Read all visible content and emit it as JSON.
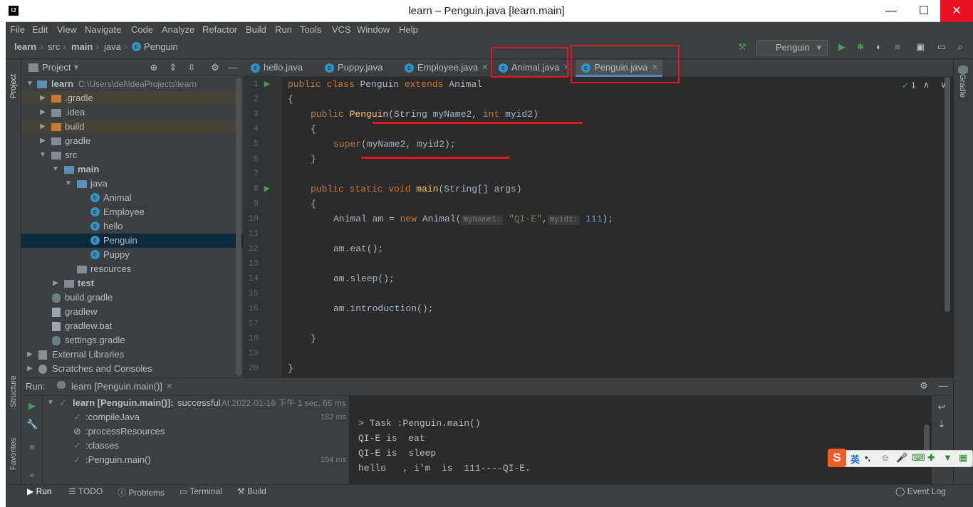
{
  "window": {
    "title": "learn – Penguin.java [learn.main]",
    "minimize": "—",
    "maximize": "☐",
    "close": "✕"
  },
  "menu": [
    "File",
    "Edit",
    "View",
    "Navigate",
    "Code",
    "Analyze",
    "Refactor",
    "Build",
    "Run",
    "Tools",
    "VCS",
    "Window",
    "Help"
  ],
  "breadcrumb": [
    "learn",
    "src",
    "main",
    "java",
    "Penguin"
  ],
  "run_config": "Penguin",
  "project_panel": {
    "title": "Project",
    "dropdown_icon": "▾"
  },
  "tree": [
    {
      "label": "learn",
      "path": "C:\\Users\\del\\IdeaProjects\\learn",
      "bold": true
    },
    {
      "label": ".gradle"
    },
    {
      "label": ".idea"
    },
    {
      "label": "build"
    },
    {
      "label": "gradle"
    },
    {
      "label": "src"
    },
    {
      "label": "main"
    },
    {
      "label": "java"
    },
    {
      "label": "Animal"
    },
    {
      "label": "Employee"
    },
    {
      "label": "hello"
    },
    {
      "label": "Penguin"
    },
    {
      "label": "Puppy"
    },
    {
      "label": "resources"
    },
    {
      "label": "test"
    },
    {
      "label": "build.gradle"
    },
    {
      "label": "gradlew"
    },
    {
      "label": "gradlew.bat"
    },
    {
      "label": "settings.gradle"
    },
    {
      "label": "External Libraries"
    },
    {
      "label": "Scratches and Consoles"
    }
  ],
  "editor_tabs": [
    "hello.java",
    "Puppy.java",
    "Employee.java",
    "Animal.java",
    "Penguin.java"
  ],
  "active_tab": "Penguin.java",
  "inspection": {
    "count": "1",
    "up": "∧",
    "down": "∨"
  },
  "code": {
    "line_numbers": [
      "1",
      "2",
      "3",
      "4",
      "5",
      "6",
      "7",
      "8",
      "9",
      "10",
      "11",
      "12",
      "13",
      "14",
      "15",
      "16",
      "17",
      "18",
      "19",
      "20"
    ],
    "l1": {
      "kw1": "public",
      "kw2": "class",
      "name": " Penguin ",
      "kw3": "extends",
      "rest": " Animal"
    },
    "l2": "{",
    "l3": {
      "kw": "public",
      "fn": "Penguin",
      "p1": "(String myName2, ",
      "kw2": "int",
      "p2": " myid2)"
    },
    "l4": "{",
    "l5": {
      "kw": "super",
      "rest": "(myName2, myid2);"
    },
    "l6": "}",
    "l8": {
      "kw1": "public",
      "kw2": "static",
      "kw3": "void",
      "fn": "main",
      "rest": "(String[] args)"
    },
    "l9": "{",
    "l10": {
      "a": "Animal am = ",
      "kw": "new",
      "b": " Animal(",
      "hint1": "myName1:",
      "s": "\"QI-E\"",
      "c": ",",
      "hint2": "myid1:",
      "n": "111",
      "d": ");"
    },
    "l12": "am.eat();",
    "l14": "am.sleep();",
    "l16": "am.introduction();",
    "l18": "}",
    "l20": "}"
  },
  "run_panel": {
    "label": "Run:",
    "tab": "learn [Penguin.main()]",
    "tree": [
      {
        "label": "learn [Penguin.main()]:",
        "status": "successful",
        "meta": "At 2022-01-16 下午 1 sec, 66 ms"
      },
      {
        "label": ":compileJava",
        "time": "182 ms"
      },
      {
        "label": ":processResources",
        "time": ""
      },
      {
        "label": ":classes",
        "time": ""
      },
      {
        "label": ":Penguin.main()",
        "time": "194 ms"
      }
    ],
    "console": [
      "> Task :Penguin.main()",
      "QI-E is  eat",
      "QI-E is  sleep",
      "hello   , i'm  is  111----QI-E."
    ]
  },
  "bottom_tabs": [
    "Run",
    "TODO",
    "Problems",
    "Terminal",
    "Build"
  ],
  "event_log": "Event Log",
  "side_strips": {
    "left_top": "Project",
    "left_mid": "Structure",
    "left_bottom": "Favorites",
    "right": "Gradle"
  },
  "ime": {
    "logo": "S",
    "lang": "英"
  },
  "colors": {
    "highlight_red": "#e0171b",
    "keyword": "#cc7832",
    "function": "#ffc66d",
    "string": "#6a8759",
    "number": "#6897bb"
  }
}
